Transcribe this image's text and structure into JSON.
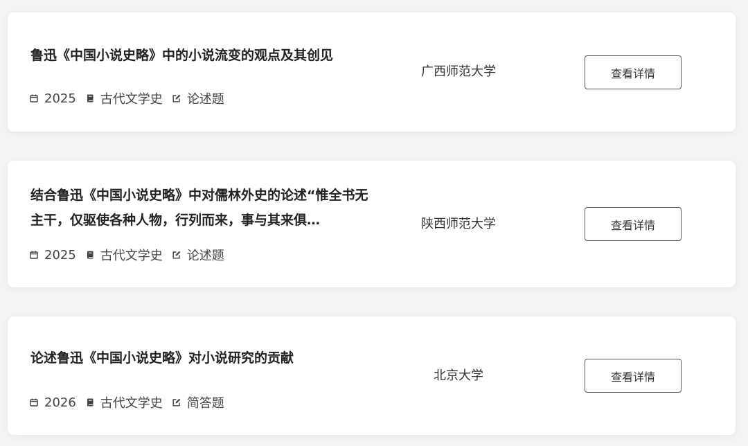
{
  "items": [
    {
      "title": "鲁迅《中国小说史略》中的小说流变的观点及其创见",
      "year": "2025",
      "subject": "古代文学史",
      "question_type": "论述题",
      "school": "广西师范大学",
      "button_label": "查看详情"
    },
    {
      "title": "结合鲁迅《中国小说史略》中对儒林外史的论述“惟全书无主干，仅驱使各种人物，行列而来，事与其来俱…",
      "year": "2025",
      "subject": "古代文学史",
      "question_type": "论述题",
      "school": "陕西师范大学",
      "button_label": "查看详情"
    },
    {
      "title": "论述鲁迅《中国小说史略》对小说研究的贡献",
      "year": "2026",
      "subject": "古代文学史",
      "question_type": "简答题",
      "school": "北京大学",
      "button_label": "查看详情"
    }
  ],
  "icons": {
    "year": "calendar-icon",
    "subject": "book-icon",
    "question_type": "edit-icon"
  },
  "colors": {
    "background": "#f4f4f4",
    "card": "#ffffff",
    "text": "#2b2b2b",
    "button_border": "#555555"
  }
}
